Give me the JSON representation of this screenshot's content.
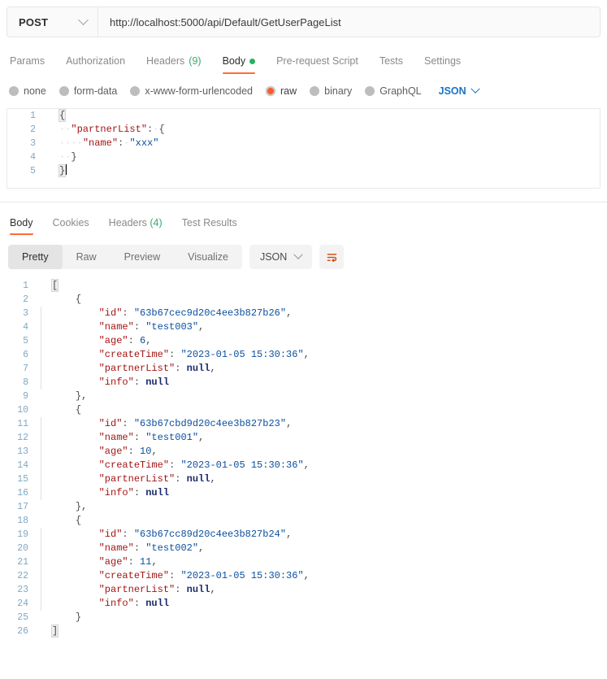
{
  "request": {
    "method": "POST",
    "url": "http://localhost:5000/api/Default/GetUserPageList",
    "tabs": [
      {
        "label": "Params",
        "active": false,
        "count": null,
        "dot": false
      },
      {
        "label": "Authorization",
        "active": false,
        "count": null,
        "dot": false
      },
      {
        "label": "Headers",
        "active": false,
        "count": "(9)",
        "dot": false
      },
      {
        "label": "Body",
        "active": true,
        "count": null,
        "dot": true
      },
      {
        "label": "Pre-request Script",
        "active": false,
        "count": null,
        "dot": false
      },
      {
        "label": "Tests",
        "active": false,
        "count": null,
        "dot": false
      },
      {
        "label": "Settings",
        "active": false,
        "count": null,
        "dot": false
      }
    ],
    "body_modes": [
      {
        "label": "none",
        "selected": false
      },
      {
        "label": "form-data",
        "selected": false
      },
      {
        "label": "x-www-form-urlencoded",
        "selected": false
      },
      {
        "label": "raw",
        "selected": true
      },
      {
        "label": "binary",
        "selected": false
      },
      {
        "label": "GraphQL",
        "selected": false
      }
    ],
    "format": "JSON",
    "body_lines": [
      {
        "n": "1",
        "text": "{"
      },
      {
        "n": "2",
        "text": "    \"partnerList\": {"
      },
      {
        "n": "3",
        "text": "        \"name\": \"xxx\""
      },
      {
        "n": "4",
        "text": "    }"
      },
      {
        "n": "5",
        "text": "}"
      }
    ]
  },
  "response": {
    "tabs": [
      {
        "label": "Body",
        "active": true,
        "count": null
      },
      {
        "label": "Cookies",
        "active": false,
        "count": null
      },
      {
        "label": "Headers",
        "active": false,
        "count": "(4)"
      },
      {
        "label": "Test Results",
        "active": false,
        "count": null
      }
    ],
    "view_modes": [
      {
        "label": "Pretty",
        "active": true
      },
      {
        "label": "Raw",
        "active": false
      },
      {
        "label": "Preview",
        "active": false
      },
      {
        "label": "Visualize",
        "active": false
      }
    ],
    "format": "JSON",
    "wrap_icon": "wrap-text-icon",
    "items": [
      {
        "id": "63b67cec9d20c4ee3b827b26",
        "name": "test003",
        "age": 6,
        "createTime": "2023-01-05 15:30:36",
        "partnerList": null,
        "info": null
      },
      {
        "id": "63b67cbd9d20c4ee3b827b23",
        "name": "test001",
        "age": 10,
        "createTime": "2023-01-05 15:30:36",
        "partnerList": null,
        "info": null
      },
      {
        "id": "63b67cc89d20c4ee3b827b24",
        "name": "test002",
        "age": 11,
        "createTime": "2023-01-05 15:30:36",
        "partnerList": null,
        "info": null
      }
    ],
    "total_lines": 26
  },
  "colors": {
    "accent": "#ff6c37",
    "green": "#29b161",
    "link": "#1a73c4",
    "key": "#a31515",
    "string": "#0b4f9e",
    "null": "#1b2a6b"
  }
}
